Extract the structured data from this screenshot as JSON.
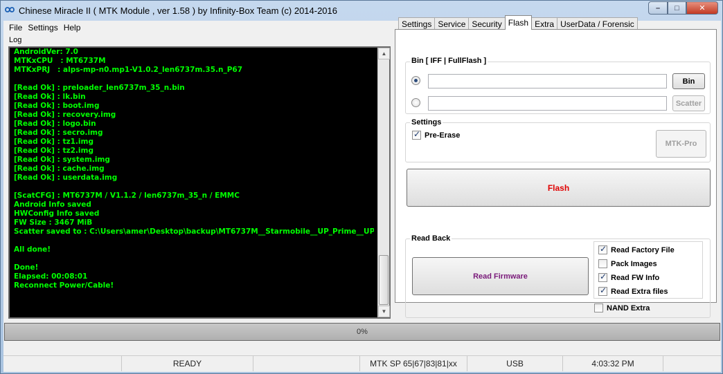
{
  "window": {
    "title": "Chinese Miracle II ( MTK Module , ver 1.58 ) by Infinity-Box Team (c) 2014-2016",
    "icon": "infinity-logo-icon",
    "controls": {
      "minimize": "–",
      "maximize": "□",
      "close": "✕"
    }
  },
  "menu": [
    "File",
    "Settings",
    "Help"
  ],
  "log": {
    "label": "Log",
    "lines": [
      "AndroidVer: 7.0",
      "MTKxCPU   : MT6737M",
      "MTKxPRJ   : alps-mp-n0.mp1-V1.0.2_len6737m.35.n_P67",
      "",
      "[Read Ok] : preloader_len6737m_35_n.bin",
      "[Read Ok] : lk.bin",
      "[Read Ok] : boot.img",
      "[Read Ok] : recovery.img",
      "[Read Ok] : logo.bin",
      "[Read Ok] : secro.img",
      "[Read Ok] : tz1.img",
      "[Read Ok] : tz2.img",
      "[Read Ok] : system.img",
      "[Read Ok] : cache.img",
      "[Read Ok] : userdata.img",
      "",
      "[ScatCFG] : MT6737M / V1.1.2 / len6737m_35_n / EMMC",
      "Android Info saved",
      "HWConfig Info saved",
      "FW Size : 3467 MiB",
      "Scatter saved to : C:\\Users\\amer\\Desktop\\backup\\MT6737M__Starmobile__UP_Prime__UP",
      "",
      "All done!",
      "",
      "Done!",
      "Elapsed: 00:08:01",
      "Reconnect Power/Cable!"
    ]
  },
  "tabs": [
    "Settings",
    "Service",
    "Security",
    "Flash",
    "Extra",
    "UserData / Forensic"
  ],
  "active_tab": "Flash",
  "flash": {
    "bin_group_label": "Bin  [ IFF | FullFlash ]",
    "bin_path": "",
    "scatter_path": "",
    "bin_button": "Bin",
    "scatter_button": "Scatter",
    "settings_label": "Settings",
    "pre_erase_label": "Pre-Erase",
    "pre_erase_checked": true,
    "mtk_pro_button": "MTK-Pro",
    "flash_button": "Flash",
    "readback_label": "Read Back",
    "read_firmware_button": "Read Firmware",
    "options": [
      {
        "label": "Read Factory File",
        "checked": true
      },
      {
        "label": "Pack Images",
        "checked": false
      },
      {
        "label": "Read FW Info",
        "checked": true
      },
      {
        "label": "Read Extra files",
        "checked": true
      }
    ],
    "nand_extra_label": "NAND Extra",
    "nand_extra_checked": false,
    "colors": {
      "flash_text": "#e00000",
      "read_firmware_text": "#7a1a7a"
    }
  },
  "progress": {
    "value_percent": 0,
    "text": "0%"
  },
  "statusbar": [
    "",
    "READY",
    "",
    "MTK SP 65|67|83|81|xx",
    "USB",
    "4:03:32 PM",
    ""
  ]
}
